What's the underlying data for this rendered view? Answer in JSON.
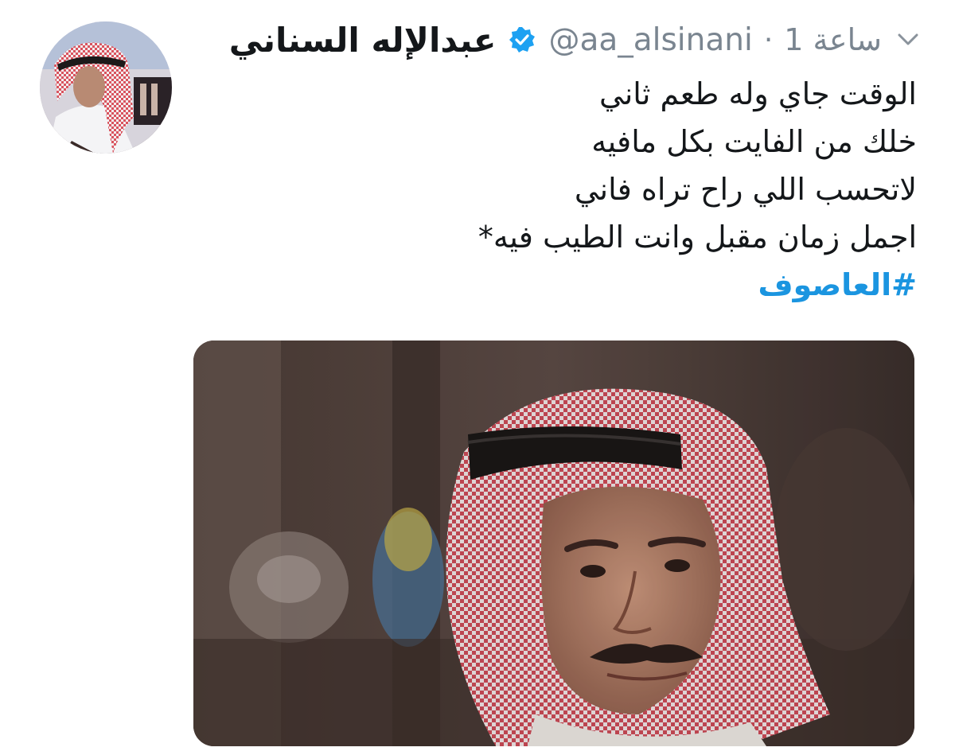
{
  "tweet": {
    "display_name": "عبدالإله السناني",
    "handle": "@aa_alsinani",
    "separator": "·",
    "time": "1 ساعة",
    "verified_icon": "verified-badge-icon",
    "menu_icon": "chevron-down-icon",
    "text_lines": [
      "الوقت جاي وله طعم ثاني",
      "خلك من الفايت بكل مافيه",
      "لاتحسب اللي راح تراه فاني",
      "اجمل زمان مقبل وانت الطيب فيه*"
    ],
    "hashtag": "#العاصوف",
    "colors": {
      "hashtag": "#1b95e0",
      "verified": "#1da1f2",
      "secondary_text": "#7a8590",
      "primary_text": "#14171a"
    }
  }
}
